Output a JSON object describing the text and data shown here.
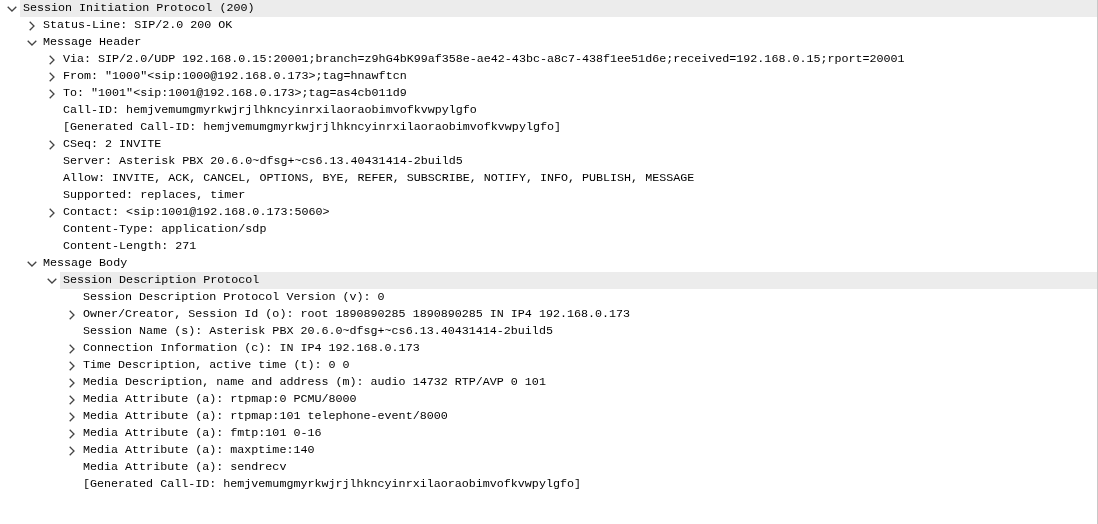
{
  "tree": [
    {
      "label": "Session Initiation Protocol (200)",
      "kind": "branch",
      "expanded": true,
      "highlighted": true,
      "children": [
        {
          "label": "Status-Line: SIP/2.0 200 OK",
          "kind": "branch",
          "expanded": false,
          "highlighted": false
        },
        {
          "label": "Message Header",
          "kind": "branch",
          "expanded": true,
          "highlighted": false,
          "children": [
            {
              "label": "Via: SIP/2.0/UDP 192.168.0.15:20001;branch=z9hG4bK99af358e-ae42-43bc-a8c7-438f1ee51d6e;received=192.168.0.15;rport=20001",
              "kind": "branch",
              "expanded": false,
              "highlighted": false
            },
            {
              "label": "From: \"1000\"<sip:1000@192.168.0.173>;tag=hnawftcn",
              "kind": "branch",
              "expanded": false,
              "highlighted": false
            },
            {
              "label": "To: \"1001\"<sip:1001@192.168.0.173>;tag=as4cb011d9",
              "kind": "branch",
              "expanded": false,
              "highlighted": false
            },
            {
              "label": "Call-ID: hemjvemumgmyrkwjrjlhkncyinrxilaoraobimvofkvwpylgfo",
              "kind": "leaf",
              "highlighted": false
            },
            {
              "label": "[Generated Call-ID: hemjvemumgmyrkwjrjlhkncyinrxilaoraobimvofkvwpylgfo]",
              "kind": "leaf",
              "highlighted": false
            },
            {
              "label": "CSeq: 2 INVITE",
              "kind": "branch",
              "expanded": false,
              "highlighted": false
            },
            {
              "label": "Server: Asterisk PBX 20.6.0~dfsg+~cs6.13.40431414-2build5",
              "kind": "leaf",
              "highlighted": false
            },
            {
              "label": "Allow: INVITE, ACK, CANCEL, OPTIONS, BYE, REFER, SUBSCRIBE, NOTIFY, INFO, PUBLISH, MESSAGE",
              "kind": "leaf",
              "highlighted": false
            },
            {
              "label": "Supported: replaces, timer",
              "kind": "leaf",
              "highlighted": false
            },
            {
              "label": "Contact: <sip:1001@192.168.0.173:5060>",
              "kind": "branch",
              "expanded": false,
              "highlighted": false
            },
            {
              "label": "Content-Type: application/sdp",
              "kind": "leaf",
              "highlighted": false
            },
            {
              "label": "Content-Length: 271",
              "kind": "leaf",
              "highlighted": false
            }
          ]
        },
        {
          "label": "Message Body",
          "kind": "branch",
          "expanded": true,
          "highlighted": false,
          "children": [
            {
              "label": "Session Description Protocol",
              "kind": "branch",
              "expanded": true,
              "highlighted": true,
              "children": [
                {
                  "label": "Session Description Protocol Version (v): 0",
                  "kind": "leaf",
                  "highlighted": false
                },
                {
                  "label": "Owner/Creator, Session Id (o): root 1890890285 1890890285 IN IP4 192.168.0.173",
                  "kind": "branch",
                  "expanded": false,
                  "highlighted": false
                },
                {
                  "label": "Session Name (s): Asterisk PBX 20.6.0~dfsg+~cs6.13.40431414-2build5",
                  "kind": "leaf",
                  "highlighted": false
                },
                {
                  "label": "Connection Information (c): IN IP4 192.168.0.173",
                  "kind": "branch",
                  "expanded": false,
                  "highlighted": false
                },
                {
                  "label": "Time Description, active time (t): 0 0",
                  "kind": "branch",
                  "expanded": false,
                  "highlighted": false
                },
                {
                  "label": "Media Description, name and address (m): audio 14732 RTP/AVP 0 101",
                  "kind": "branch",
                  "expanded": false,
                  "highlighted": false
                },
                {
                  "label": "Media Attribute (a): rtpmap:0 PCMU/8000",
                  "kind": "branch",
                  "expanded": false,
                  "highlighted": false
                },
                {
                  "label": "Media Attribute (a): rtpmap:101 telephone-event/8000",
                  "kind": "branch",
                  "expanded": false,
                  "highlighted": false
                },
                {
                  "label": "Media Attribute (a): fmtp:101 0-16",
                  "kind": "branch",
                  "expanded": false,
                  "highlighted": false
                },
                {
                  "label": "Media Attribute (a): maxptime:140",
                  "kind": "branch",
                  "expanded": false,
                  "highlighted": false
                },
                {
                  "label": "Media Attribute (a): sendrecv",
                  "kind": "leaf",
                  "highlighted": false
                },
                {
                  "label": "[Generated Call-ID: hemjvemumgmyrkwjrjlhkncyinrxilaoraobimvofkvwpylgfo]",
                  "kind": "leaf",
                  "highlighted": false
                }
              ]
            }
          ]
        }
      ]
    }
  ]
}
